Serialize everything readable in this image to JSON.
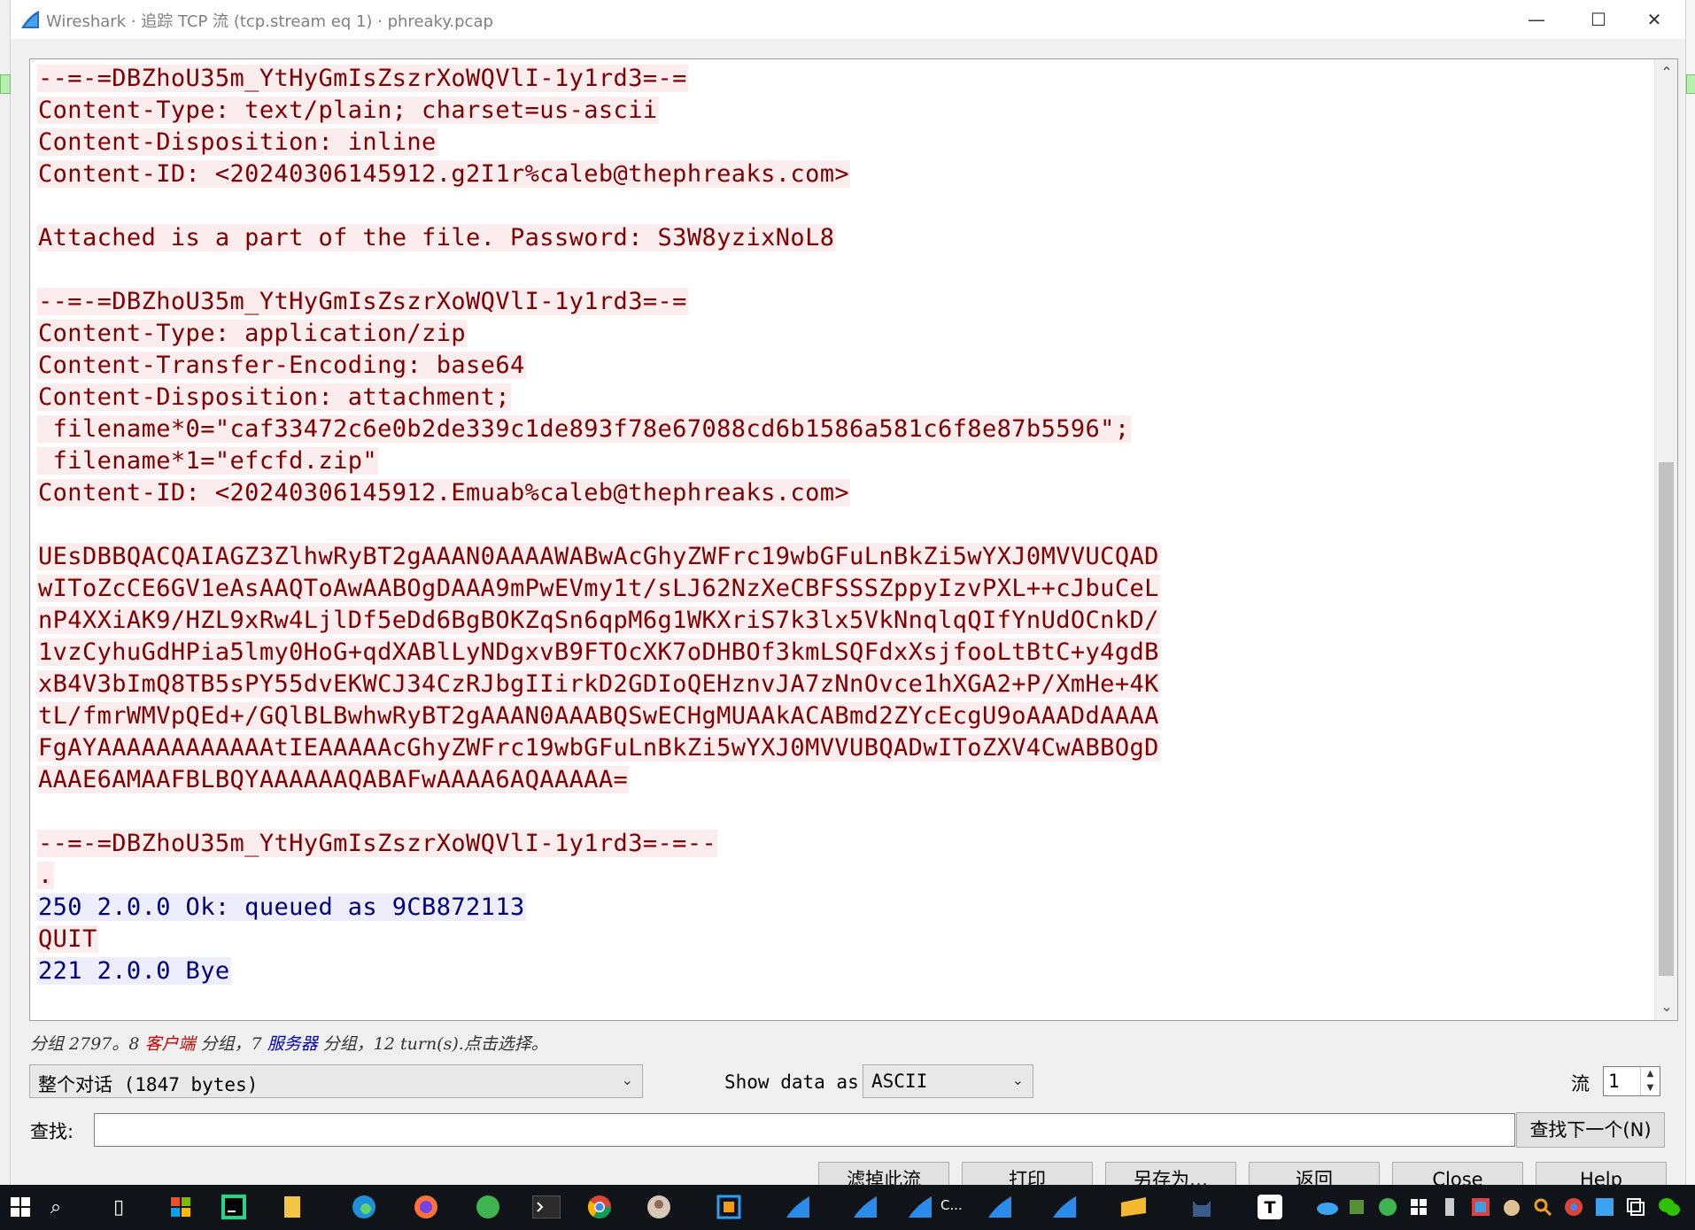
{
  "window": {
    "title": "Wireshark · 追踪 TCP 流 (tcp.stream eq 1) · phreaky.pcap",
    "minimize": "—",
    "maximize": "☐",
    "close": "✕"
  },
  "stream": {
    "lines": [
      {
        "role": "client",
        "text": "--=-=DBZhoU35m_YtHyGmIsZszrXoWQVlI-1y1rd3=-="
      },
      {
        "role": "client",
        "text": "Content-Type: text/plain; charset=us-ascii"
      },
      {
        "role": "client",
        "text": "Content-Disposition: inline"
      },
      {
        "role": "client",
        "text": "Content-ID: <20240306145912.g2I1r%caleb@thephreaks.com>"
      },
      {
        "role": "blank",
        "text": ""
      },
      {
        "role": "client",
        "text": "Attached is a part of the file. Password: S3W8yzixNoL8"
      },
      {
        "role": "blank",
        "text": ""
      },
      {
        "role": "client",
        "text": "--=-=DBZhoU35m_YtHyGmIsZszrXoWQVlI-1y1rd3=-="
      },
      {
        "role": "client",
        "text": "Content-Type: application/zip"
      },
      {
        "role": "client",
        "text": "Content-Transfer-Encoding: base64"
      },
      {
        "role": "client",
        "text": "Content-Disposition: attachment;"
      },
      {
        "role": "client",
        "text": " filename*0=\"caf33472c6e0b2de339c1de893f78e67088cd6b1586a581c6f8e87b5596\";"
      },
      {
        "role": "client",
        "text": " filename*1=\"efcfd.zip\""
      },
      {
        "role": "client",
        "text": "Content-ID: <20240306145912.Emuab%caleb@thephreaks.com>"
      },
      {
        "role": "blank",
        "text": ""
      },
      {
        "role": "client",
        "text": "UEsDBBQACQAIAGZ3ZlhwRyBT2gAAAN0AAAAWABwAcGhyZWFrc19wbGFuLnBkZi5wYXJ0MVVUCQAD"
      },
      {
        "role": "client",
        "text": "wIToZcCE6GV1eAsAAQToAwAABOgDAAA9mPwEVmy1t/sLJ62NzXeCBFSSSZppyIzvPXL++cJbuCeL"
      },
      {
        "role": "client",
        "text": "nP4XXiAK9/HZL9xRw4LjlDf5eDd6BgBOKZqSn6qpM6g1WKXriS7k3lx5VkNnqlqQIfYnUdOCnkD/"
      },
      {
        "role": "client",
        "text": "1vzCyhuGdHPia5lmy0HoG+qdXABlLyNDgxvB9FTOcXK7oDHBOf3kmLSQFdxXsjfooLtBtC+y4gdB"
      },
      {
        "role": "client",
        "text": "xB4V3bImQ8TB5sPY55dvEKWCJ34CzRJbgIIirkD2GDIoQEHznvJA7zNnOvce1hXGA2+P/XmHe+4K"
      },
      {
        "role": "client",
        "text": "tL/fmrWMVpQEd+/GQlBLBwhwRyBT2gAAAN0AAABQSwECHgMUAAkACABmd2ZYcEcgU9oAAADdAAAA"
      },
      {
        "role": "client",
        "text": "FgAYAAAAAAAAAAAAtIEAAAAAcGhyZWFrc19wbGFuLnBkZi5wYXJ0MVVUBQADwIToZXV4CwABBOgD"
      },
      {
        "role": "client",
        "text": "AAAE6AMAAFBLBQYAAAAAAQABAFwAAAA6AQAAAAA="
      },
      {
        "role": "blank",
        "text": ""
      },
      {
        "role": "client",
        "text": "--=-=DBZhoU35m_YtHyGmIsZszrXoWQVlI-1y1rd3=-=--"
      },
      {
        "role": "client",
        "text": "."
      },
      {
        "role": "server",
        "text": "250 2.0.0 Ok: queued as 9CB872113"
      },
      {
        "role": "client",
        "text": "QUIT"
      },
      {
        "role": "server",
        "text": "221 2.0.0 Bye"
      }
    ]
  },
  "info": {
    "prefix": "分组 2797。8 ",
    "client_word": "客户端",
    "middle": " 分组，7 ",
    "server_word": "服务器",
    "suffix": " 分组，12 turn(s).点击选择。"
  },
  "controls": {
    "conversation": "整个对话 (1847 bytes)",
    "show_data_label": "Show data as",
    "show_data_value": "ASCII",
    "stream_label": "流",
    "stream_value": "1",
    "find_label": "查找:",
    "find_value": "",
    "find_next": "查找下一个(N)"
  },
  "buttons": {
    "filter_out": "滤掉此流",
    "print": "打印",
    "save_as": "另存为…",
    "back": "返回",
    "close": "Close",
    "help": "Help"
  },
  "taskbar": {
    "running_label": "C..."
  },
  "colors": {
    "client_fg": "#7f0000",
    "client_bg": "#fbeded",
    "server_fg": "#00007f",
    "server_bg": "#ededfb"
  }
}
